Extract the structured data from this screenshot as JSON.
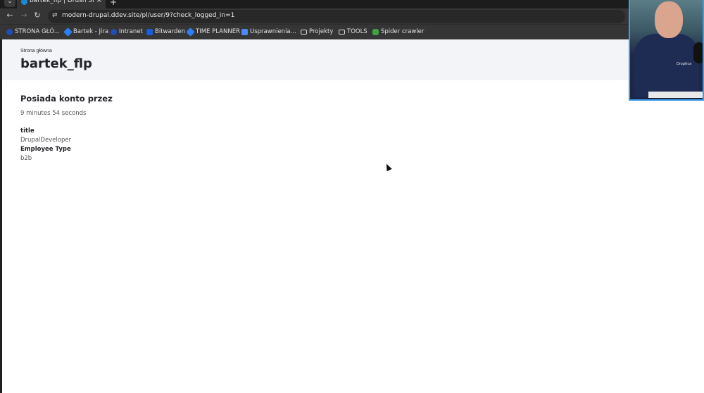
{
  "browser": {
    "tab": {
      "title": "bartek_flp | Drush Site-I",
      "close_icon": "×"
    },
    "new_tab_icon": "+",
    "tab_dropdown_icon": "⌄",
    "nav": {
      "back_icon": "←",
      "forward_icon": "→",
      "reload_icon": "↻",
      "site_info_icon": "⇄"
    },
    "url": "modern-drupal.ddev.site/pl/user/9?check_logged_in=1",
    "bookmarks": [
      {
        "label": "STRONA GŁÓ...",
        "icon": "drupal-icon",
        "color": "#1f4fb5"
      },
      {
        "label": "Bartek - Jira",
        "icon": "jira-icon",
        "color": "#2d7ff9"
      },
      {
        "label": "Intranet",
        "icon": "drupal-icon",
        "color": "#1f4fb5"
      },
      {
        "label": "Bitwarden",
        "icon": "bitwarden-icon",
        "color": "#175ddc"
      },
      {
        "label": "TIME PLANNER",
        "icon": "jira-icon",
        "color": "#2d7ff9"
      },
      {
        "label": "Usprawnienia...",
        "icon": "docs-icon",
        "color": "#4a8af4"
      },
      {
        "label": "Projekty",
        "icon": "folder-icon",
        "color": "#e0e0e0"
      },
      {
        "label": "TOOLS",
        "icon": "folder-icon",
        "color": "#e0e0e0"
      },
      {
        "label": "Spider crawler",
        "icon": "spider-icon",
        "color": "#3fa33f"
      }
    ]
  },
  "page": {
    "breadcrumb": "Strona główna",
    "title": "bartek_flp",
    "member_for": {
      "heading": "Posiada konto przez",
      "value": "9 minutes 54 seconds"
    },
    "fields": [
      {
        "label": "title",
        "value": "DrupalDeveloper"
      },
      {
        "label": "Employee Type",
        "value": "b2b"
      }
    ]
  },
  "webcam": {
    "logo_text": "Droptica"
  }
}
